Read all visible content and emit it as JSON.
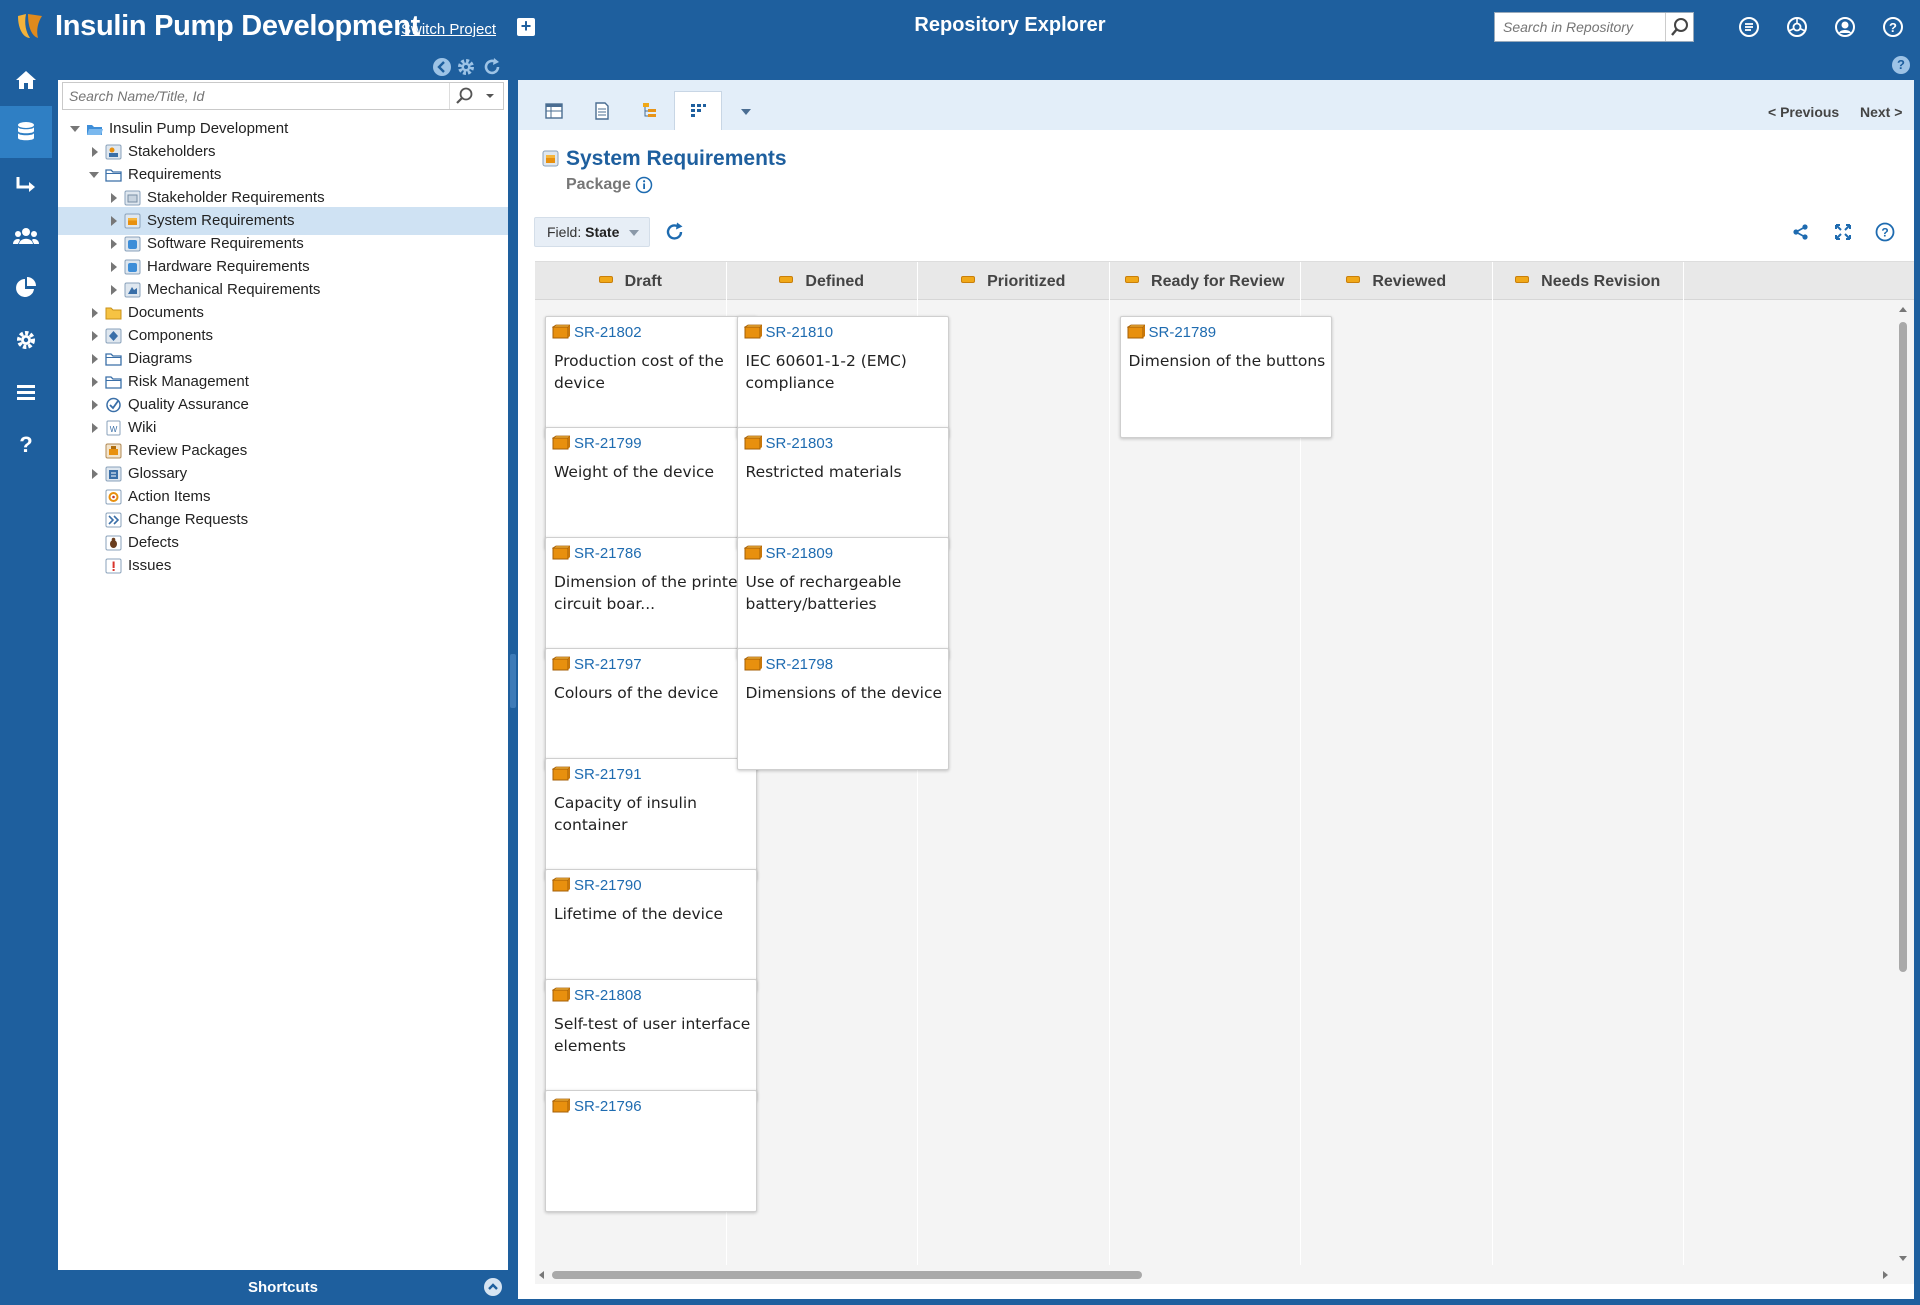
{
  "header": {
    "project_title": "Insulin Pump Development",
    "switch_project": "Switch Project",
    "center_title": "Repository Explorer",
    "search_placeholder": "Search in Repository"
  },
  "tree": {
    "search_placeholder": "Search Name/Title, Id",
    "items": [
      {
        "label": "Insulin Pump Development"
      },
      {
        "label": "Stakeholders"
      },
      {
        "label": "Requirements"
      },
      {
        "label": "Stakeholder Requirements"
      },
      {
        "label": "System Requirements"
      },
      {
        "label": "Software Requirements"
      },
      {
        "label": "Hardware Requirements"
      },
      {
        "label": "Mechanical Requirements"
      },
      {
        "label": "Documents"
      },
      {
        "label": "Components"
      },
      {
        "label": "Diagrams"
      },
      {
        "label": "Risk Management"
      },
      {
        "label": "Quality Assurance"
      },
      {
        "label": "Wiki"
      },
      {
        "label": "Review Packages"
      },
      {
        "label": "Glossary"
      },
      {
        "label": "Action Items"
      },
      {
        "label": "Change Requests"
      },
      {
        "label": "Defects"
      },
      {
        "label": "Issues"
      }
    ],
    "shortcuts_label": "Shortcuts"
  },
  "main": {
    "prev_label": "< Previous",
    "next_label": "Next >",
    "title": "System Requirements",
    "subtype": "Package",
    "field_prefix": "Field:",
    "field_value": "State"
  },
  "board": {
    "columns": [
      {
        "label": "Draft"
      },
      {
        "label": "Defined"
      },
      {
        "label": "Prioritized"
      },
      {
        "label": "Ready for Review"
      },
      {
        "label": "Reviewed"
      },
      {
        "label": "Needs Revision"
      }
    ],
    "cards": [
      {
        "id": "SR-21802",
        "title": "Production cost of the device"
      },
      {
        "id": "SR-21799",
        "title": "Weight of the device"
      },
      {
        "id": "SR-21786",
        "title": "Dimension of the printed circuit boar..."
      },
      {
        "id": "SR-21797",
        "title": "Colours of the device"
      },
      {
        "id": "SR-21791",
        "title": "Capacity of insulin container"
      },
      {
        "id": "SR-21790",
        "title": "Lifetime of the device"
      },
      {
        "id": "SR-21808",
        "title": "Self-test of user interface elements"
      },
      {
        "id": "SR-21796",
        "title": ""
      },
      {
        "id": "SR-21810",
        "title": "IEC 60601-1-2 (EMC) compliance"
      },
      {
        "id": "SR-21803",
        "title": "Restricted materials"
      },
      {
        "id": "SR-21809",
        "title": "Use of rechargeable battery/batteries"
      },
      {
        "id": "SR-21798",
        "title": "Dimensions of the device"
      },
      {
        "id": "SR-21789",
        "title": "Dimension of the buttons"
      }
    ]
  },
  "colors": {
    "brand": "#1e5f9e",
    "link": "#1e6bb0",
    "selected_row": "#cfe2f3",
    "state_marker": "#f0a818"
  },
  "icons": {
    "rail": [
      "home-icon",
      "database-icon",
      "arrow-right-icon",
      "users-icon",
      "pie-chart-icon",
      "gear-icon",
      "list-icon",
      "help-icon"
    ],
    "header": [
      "search-icon",
      "doc-list-icon",
      "aperture-icon",
      "user-icon",
      "help-icon"
    ]
  }
}
